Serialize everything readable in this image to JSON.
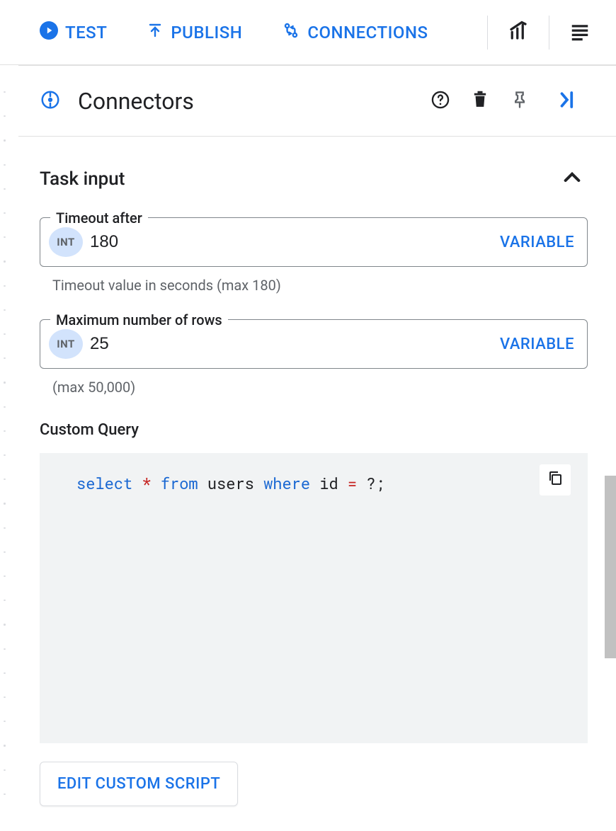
{
  "toolbar": {
    "test": "TEST",
    "publish": "PUBLISH",
    "connections": "CONNECTIONS"
  },
  "panel": {
    "title": "Connectors"
  },
  "section": {
    "title": "Task input"
  },
  "fields": {
    "timeout": {
      "label": "Timeout after",
      "type": "INT",
      "value": "180",
      "variable_btn": "VARIABLE",
      "helper": "Timeout value in seconds (max 180)"
    },
    "maxrows": {
      "label": "Maximum number of rows",
      "type": "INT",
      "value": "25",
      "variable_btn": "VARIABLE",
      "helper": "(max 50,000)"
    }
  },
  "query": {
    "label": "Custom Query",
    "tokens": {
      "select": "select",
      "star": "*",
      "from": "from",
      "users": "users",
      "where": "where",
      "id": "id",
      "eq": "=",
      "q": "?;"
    }
  },
  "buttons": {
    "edit_script": "EDIT CUSTOM SCRIPT"
  }
}
